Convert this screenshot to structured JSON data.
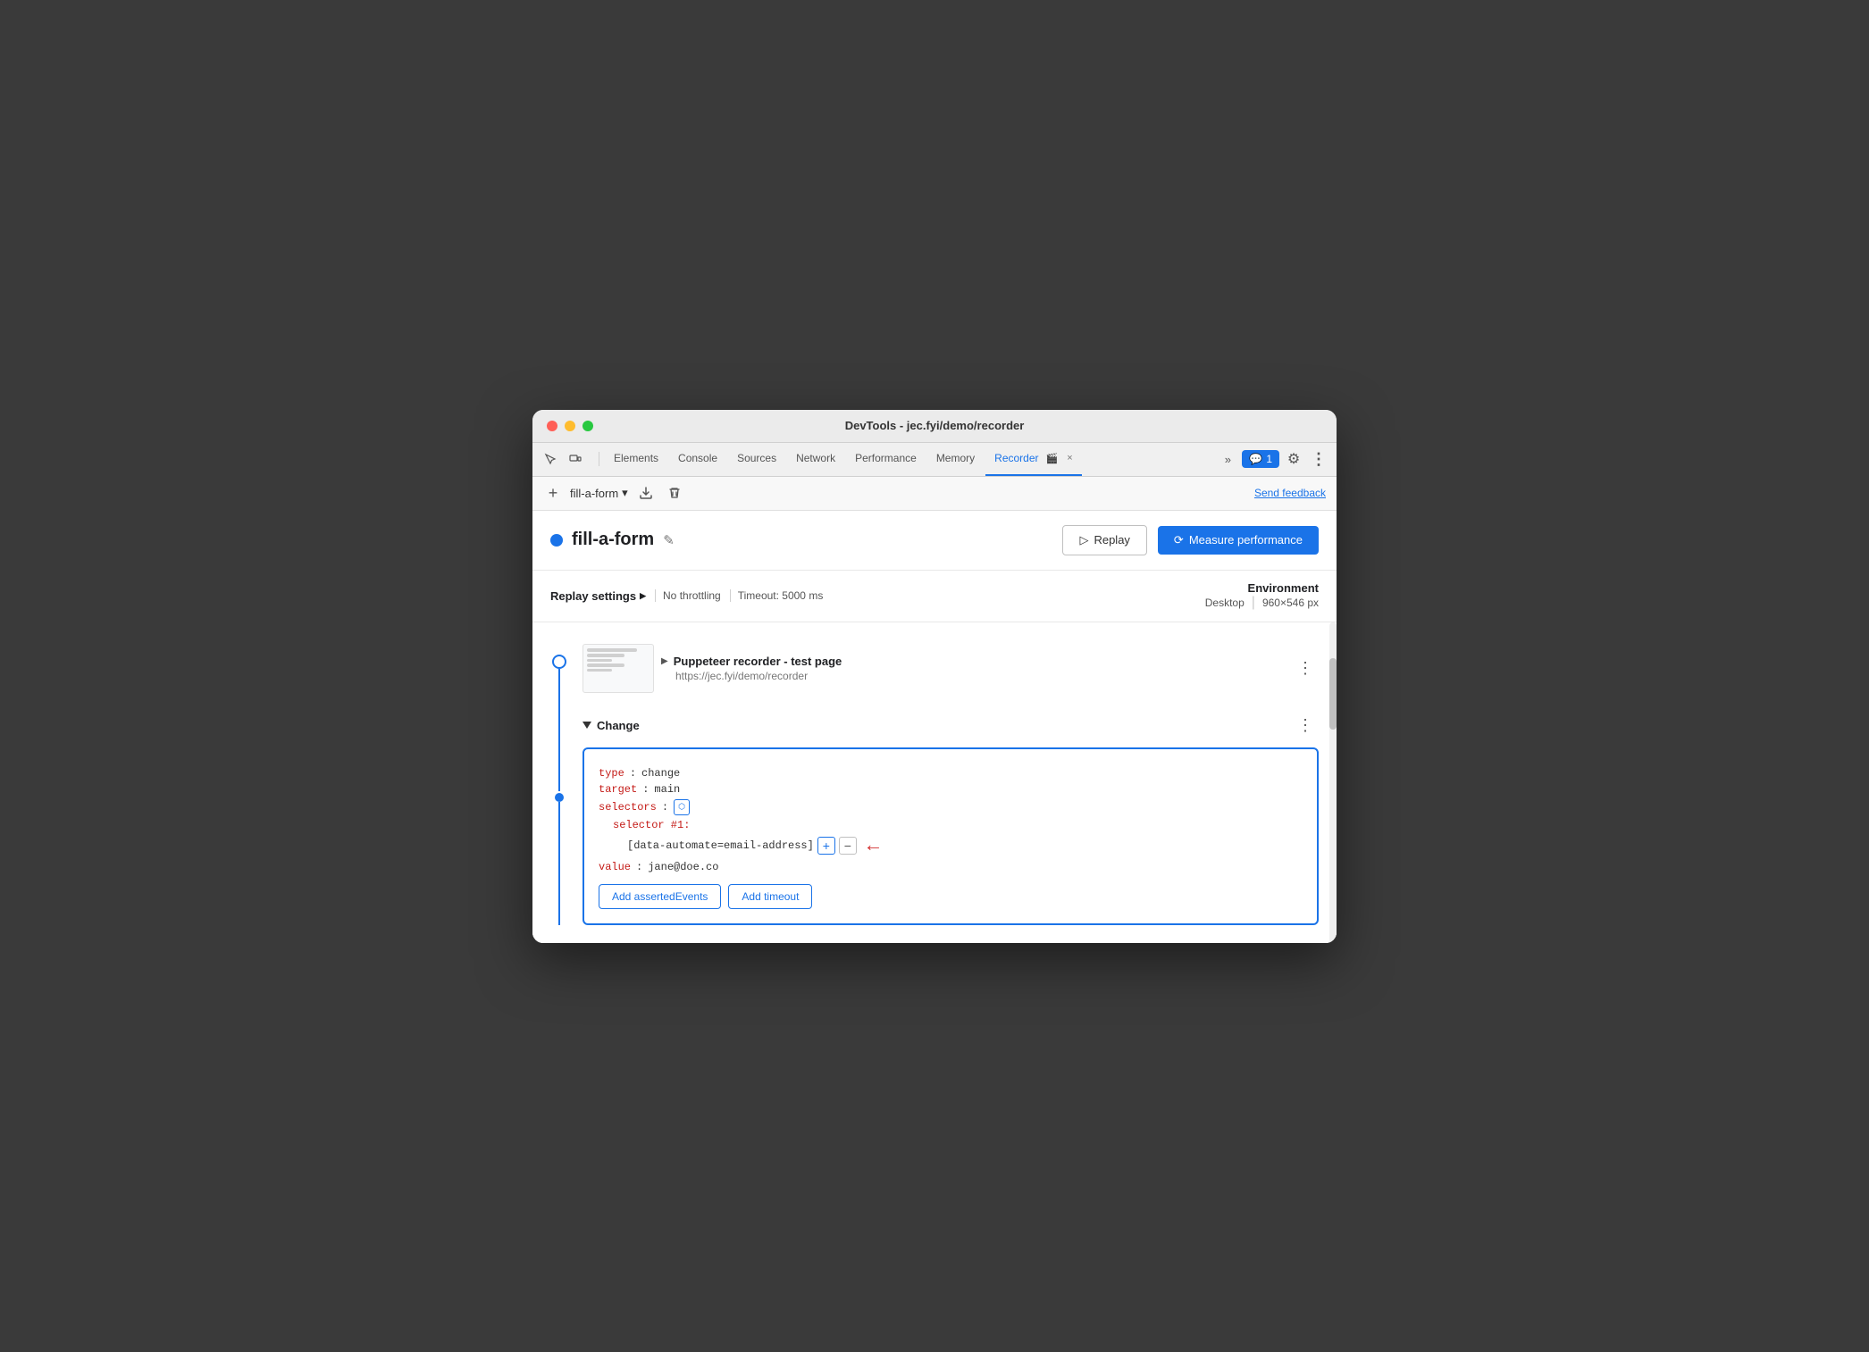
{
  "window": {
    "title": "DevTools - jec.fyi/demo/recorder"
  },
  "tabs": {
    "items": [
      {
        "label": "Elements",
        "active": false
      },
      {
        "label": "Console",
        "active": false
      },
      {
        "label": "Sources",
        "active": false
      },
      {
        "label": "Network",
        "active": false
      },
      {
        "label": "Performance",
        "active": false
      },
      {
        "label": "Memory",
        "active": false
      },
      {
        "label": "Recorder",
        "active": true
      }
    ],
    "recorder_close": "×",
    "more_tabs": "»",
    "chat_badge": "1",
    "settings_icon": "⚙",
    "more_icon": "⋮"
  },
  "toolbar": {
    "add_icon": "+",
    "recording_name": "fill-a-form",
    "chevron_icon": "▾",
    "export_icon": "↓",
    "delete_icon": "🗑",
    "send_feedback": "Send feedback"
  },
  "recording": {
    "dot_color": "#1a73e8",
    "name": "fill-a-form",
    "edit_icon": "✎",
    "replay_label": "Replay",
    "measure_label": "Measure performance",
    "measure_icon": "⟳"
  },
  "replay_settings": {
    "label": "Replay settings",
    "arrow": "▶",
    "throttling": "No throttling",
    "timeout": "Timeout: 5000 ms",
    "env_label": "Environment",
    "env_device": "Desktop",
    "env_size": "960×546 px"
  },
  "steps": [
    {
      "title": "Puppeteer recorder - test page",
      "url": "https://jec.fyi/demo/recorder",
      "expanded": false
    }
  ],
  "change_step": {
    "title": "Change",
    "expanded": true,
    "code": {
      "type_key": "type",
      "type_value": "change",
      "target_key": "target",
      "target_value": "main",
      "selectors_key": "selectors",
      "selector_num": "selector #1:",
      "selector_value": "[data-automate=email-address]",
      "value_key": "value",
      "value_val": "jane@doe.co"
    },
    "add_asserted_label": "Add assertedEvents",
    "add_timeout_label": "Add timeout"
  }
}
